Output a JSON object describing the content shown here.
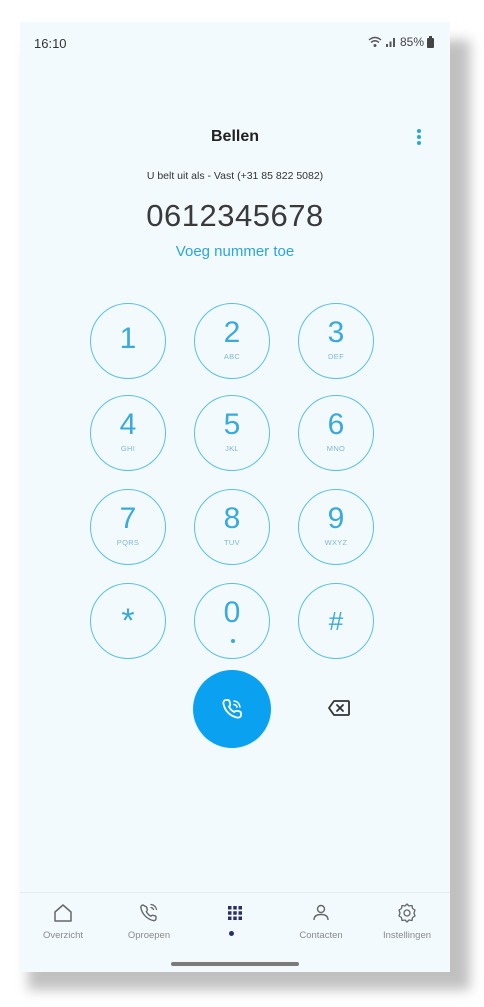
{
  "status_bar": {
    "time": "16:10",
    "battery": "85%"
  },
  "header": {
    "title": "Bellen"
  },
  "caller_id": "U belt uit als - Vast (+31 85 822 5082)",
  "dialer": {
    "number": "0612345678",
    "add_number_label": "Voeg nummer toe"
  },
  "keypad": [
    {
      "digit": "1",
      "letters": ""
    },
    {
      "digit": "2",
      "letters": "ABC"
    },
    {
      "digit": "3",
      "letters": "DEF"
    },
    {
      "digit": "4",
      "letters": "GHI"
    },
    {
      "digit": "5",
      "letters": "JKL"
    },
    {
      "digit": "6",
      "letters": "MNO"
    },
    {
      "digit": "7",
      "letters": "PQRS"
    },
    {
      "digit": "8",
      "letters": "TUV"
    },
    {
      "digit": "9",
      "letters": "WXYZ"
    },
    {
      "digit": "*",
      "letters": ""
    },
    {
      "digit": "0",
      "letters": "+"
    },
    {
      "digit": "#",
      "letters": ""
    }
  ],
  "nav": {
    "items": [
      {
        "label": "Overzicht",
        "icon": "home-icon"
      },
      {
        "label": "Oproepen",
        "icon": "phone-calls-icon"
      },
      {
        "label": "",
        "icon": "dialpad-icon"
      },
      {
        "label": "Contacten",
        "icon": "person-icon"
      },
      {
        "label": "Instellingen",
        "icon": "gear-icon"
      }
    ],
    "active_index": 2
  },
  "colors": {
    "accent": "#0aa2f0",
    "key_outline": "#58c0e6",
    "background": "#f3fafd",
    "nav_active": "#2a2f6b"
  }
}
